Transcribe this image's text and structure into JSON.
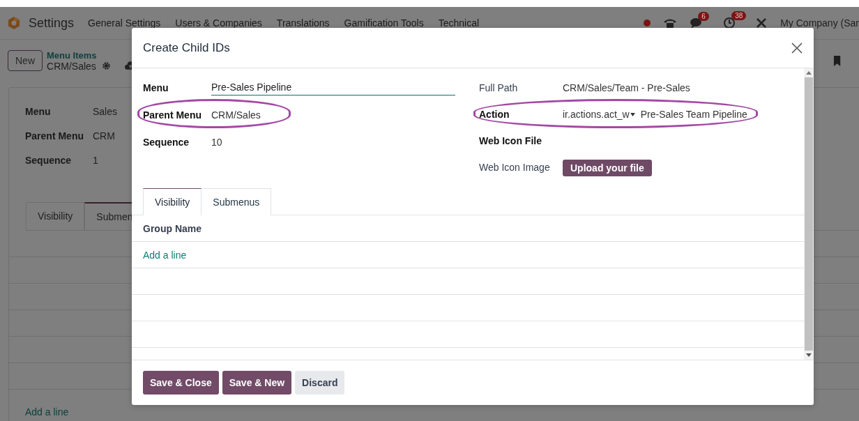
{
  "navbar": {
    "app_name": "Settings",
    "menu": [
      "General Settings",
      "Users & Companies",
      "Translations",
      "Gamification Tools",
      "Technical"
    ],
    "messages_badge": "6",
    "activities_badge": "38",
    "company": "My Company (Sar"
  },
  "control_panel": {
    "new_button": "New",
    "breadcrumb": "Menu Items",
    "record": "CRM/Sales"
  },
  "form": {
    "fields": [
      {
        "label": "Menu",
        "value": "Sales"
      },
      {
        "label": "Parent Menu",
        "value": "CRM"
      },
      {
        "label": "Sequence",
        "value": "1"
      }
    ],
    "tabs": [
      {
        "label": "Visibility",
        "selected": false
      },
      {
        "label": "Submen",
        "selected": true
      }
    ],
    "add_line": "Add a line"
  },
  "dialog": {
    "title": "Create Child IDs",
    "left_fields": [
      {
        "kind": "input",
        "label": "Menu",
        "value": "Pre-Sales Pipeline",
        "emphasized": true,
        "highlighted": false
      },
      {
        "kind": "text",
        "label": "Parent Menu",
        "value": "CRM/Sales",
        "emphasized": true,
        "highlighted": true
      },
      {
        "kind": "text",
        "label": "Sequence",
        "value": "10",
        "emphasized": true,
        "highlighted": false
      }
    ],
    "right_fields": [
      {
        "kind": "text",
        "label": "Full Path",
        "value": "CRM/Sales/Team - Pre-Sales",
        "emphasized": false,
        "highlighted": false
      },
      {
        "kind": "reference",
        "label": "Action",
        "model": "ir.actions.act_w",
        "value": "Pre-Sales Team Pipeline",
        "emphasized": true,
        "highlighted": true
      },
      {
        "kind": "text",
        "label": "Web Icon File",
        "emphasized": true,
        "highlighted": false
      },
      {
        "kind": "upload",
        "label": "Web Icon Image",
        "value": "Upload your file",
        "emphasized": false,
        "highlighted": false
      }
    ],
    "tabs": [
      {
        "label": "Visibility",
        "selected": true
      },
      {
        "label": "Submenus",
        "selected": false
      }
    ],
    "table": {
      "columns": [
        "Group Name"
      ],
      "add_line": "Add a line"
    },
    "buttons": [
      {
        "label": "Save & Close",
        "kind": "primary"
      },
      {
        "label": "Save & New",
        "kind": "primary"
      },
      {
        "label": "Discard",
        "kind": "secondary"
      }
    ]
  }
}
